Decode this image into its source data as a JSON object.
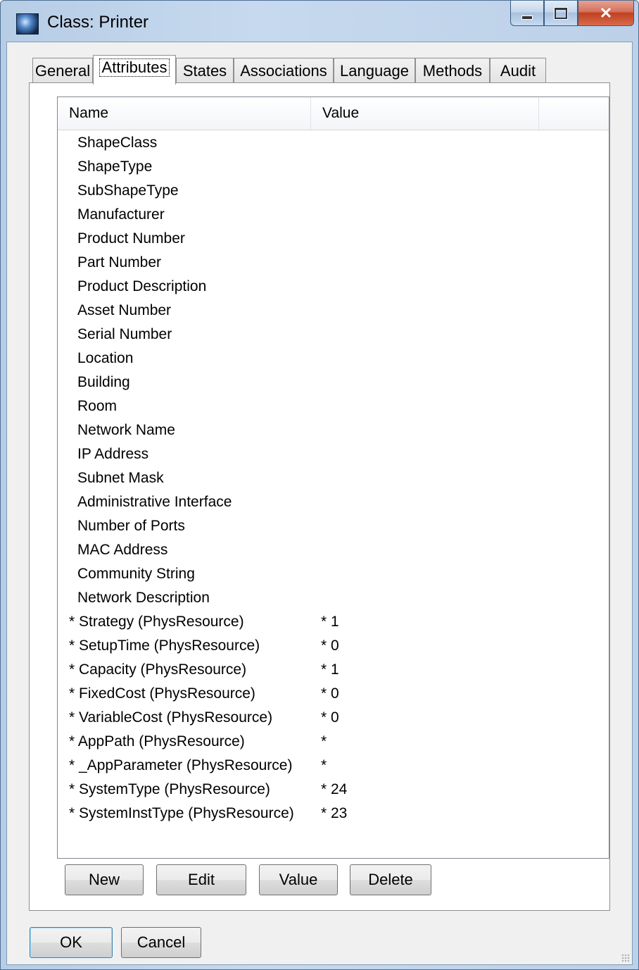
{
  "window": {
    "title": "Class: Printer"
  },
  "tabs": [
    {
      "label": "General"
    },
    {
      "label": "Attributes",
      "active": true
    },
    {
      "label": "States"
    },
    {
      "label": "Associations"
    },
    {
      "label": "Language"
    },
    {
      "label": "Methods"
    },
    {
      "label": "Audit"
    }
  ],
  "list": {
    "columns": [
      "Name",
      "Value"
    ],
    "rows": [
      {
        "name": "ShapeClass",
        "value": ""
      },
      {
        "name": "ShapeType",
        "value": ""
      },
      {
        "name": "SubShapeType",
        "value": ""
      },
      {
        "name": "Manufacturer",
        "value": ""
      },
      {
        "name": "Product Number",
        "value": ""
      },
      {
        "name": "Part Number",
        "value": ""
      },
      {
        "name": "Product Description",
        "value": ""
      },
      {
        "name": "Asset Number",
        "value": ""
      },
      {
        "name": "Serial Number",
        "value": ""
      },
      {
        "name": "Location",
        "value": ""
      },
      {
        "name": "Building",
        "value": ""
      },
      {
        "name": "Room",
        "value": ""
      },
      {
        "name": "Network Name",
        "value": ""
      },
      {
        "name": "IP Address",
        "value": ""
      },
      {
        "name": "Subnet Mask",
        "value": ""
      },
      {
        "name": "Administrative Interface",
        "value": ""
      },
      {
        "name": "Number of Ports",
        "value": ""
      },
      {
        "name": "MAC Address",
        "value": ""
      },
      {
        "name": "Community String",
        "value": ""
      },
      {
        "name": "Network Description",
        "value": ""
      },
      {
        "name": "* Strategy (PhysResource)",
        "value": "* 1"
      },
      {
        "name": "* SetupTime (PhysResource)",
        "value": "* 0"
      },
      {
        "name": "* Capacity (PhysResource)",
        "value": "* 1"
      },
      {
        "name": "* FixedCost (PhysResource)",
        "value": "* 0"
      },
      {
        "name": "* VariableCost (PhysResource)",
        "value": "* 0"
      },
      {
        "name": "* AppPath (PhysResource)",
        "value": "*"
      },
      {
        "name": "* _AppParameter (PhysResource)",
        "value": "*"
      },
      {
        "name": "* SystemType (PhysResource)",
        "value": "* 24"
      },
      {
        "name": "* SystemInstType (PhysResource)",
        "value": "* 23"
      }
    ]
  },
  "actions": {
    "new": "New",
    "edit": "Edit",
    "value": "Value",
    "delete": "Delete"
  },
  "dialog": {
    "ok": "OK",
    "cancel": "Cancel"
  }
}
